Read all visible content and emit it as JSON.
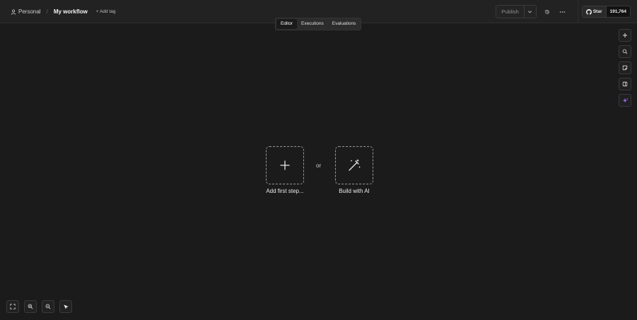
{
  "header": {
    "project_label": "Personal",
    "separator": "/",
    "workflow_name": "My workflow",
    "add_tag_label": "+ Add tag",
    "publish_label": "Publish",
    "github": {
      "star_label": "Star",
      "star_count": "191,764"
    }
  },
  "tabs": [
    {
      "label": "Editor",
      "active": true
    },
    {
      "label": "Executions",
      "active": false
    },
    {
      "label": "Evaluations",
      "active": false
    }
  ],
  "right_toolbar": {
    "icons": [
      "plus-icon",
      "search-icon",
      "sticky-note-icon",
      "panel-icon",
      "ai-sparkle-icon"
    ],
    "accent": "#a56bf5"
  },
  "canvas": {
    "add_first_step_label": "Add first step...",
    "or_label": "or",
    "build_with_ai_label": "Build with AI"
  },
  "bottom_toolbar": {
    "icons": [
      "fit-view-icon",
      "zoom-in-icon",
      "zoom-out-icon",
      "cursor-icon"
    ]
  },
  "colors": {
    "background": "#1b1b1b",
    "topbar": "#222222",
    "border": "#3a3a3a"
  }
}
